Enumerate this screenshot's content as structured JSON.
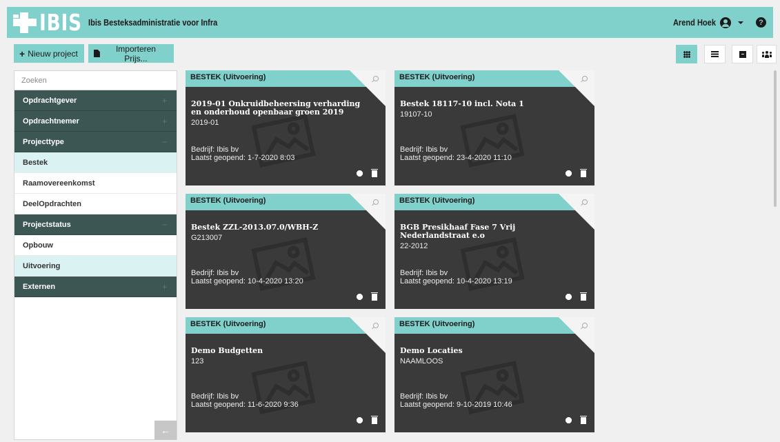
{
  "app": {
    "logo_text": "IBIS",
    "title": "Ibis Besteksadministratie voor Infra",
    "user_name": "Arend Hoek",
    "brand_color": "#80d0cc"
  },
  "toolbar": {
    "new_project_label": "Nieuw project",
    "import_label": "Importeren Prijs...",
    "views": [
      "grid-view",
      "list-view",
      "archive",
      "users"
    ]
  },
  "sidebar": {
    "search_placeholder": "Zoeken",
    "items": [
      {
        "label": "Opdrachtgever",
        "type": "group",
        "sign": "+"
      },
      {
        "label": "Opdrachtnemer",
        "type": "group",
        "sign": "+"
      },
      {
        "label": "Projecttype",
        "type": "group",
        "sign": "−"
      },
      {
        "label": "Bestek",
        "type": "item",
        "selected": true
      },
      {
        "label": "Raamovereenkomst",
        "type": "item"
      },
      {
        "label": "DeelOpdrachten",
        "type": "item"
      },
      {
        "label": "Projectstatus",
        "type": "group",
        "sign": "−"
      },
      {
        "label": "Opbouw",
        "type": "item"
      },
      {
        "label": "Uitvoering",
        "type": "item",
        "selected": true
      },
      {
        "label": "Externen",
        "type": "group",
        "sign": "+"
      }
    ]
  },
  "cards": [
    {
      "header": "BESTEK (Uitvoering)",
      "title": "2019-01 Onkruidbeheersing verharding en onderhoud openbaar groen 2019",
      "code": "2019-01",
      "company": "Bedrijf: Ibis bv",
      "last_opened": "Laatst geopend: 1-7-2020 8:03"
    },
    {
      "header": "BESTEK (Uitvoering)",
      "title": "Bestek 18117-10 incl. Nota 1",
      "code": "19107-10",
      "company": "Bedrijf: Ibis bv",
      "last_opened": "Laatst geopend: 23-4-2020 11:10"
    },
    {
      "header": "BESTEK (Uitvoering)",
      "title": "Bestek ZZL-2013.07.0/WBH-Z",
      "code": "G213007",
      "company": "Bedrijf: Ibis bv",
      "last_opened": "Laatst geopend: 10-4-2020 13:20"
    },
    {
      "header": "BESTEK (Uitvoering)",
      "title": "BGB Presikhaaf Fase 7 Vrij Nederlandstraat e.o",
      "code": "22-2012",
      "company": "Bedrijf: Ibis bv",
      "last_opened": "Laatst geopend: 10-4-2020 13:19"
    },
    {
      "header": "BESTEK (Uitvoering)",
      "title": "Demo Budgetten",
      "code": "123",
      "company": "Bedrijf: Ibis bv",
      "last_opened": "Laatst geopend: 11-6-2020 9:36"
    },
    {
      "header": "BESTEK (Uitvoering)",
      "title": "Demo Locaties",
      "code": "NAAMLOOS",
      "company": "Bedrijf: Ibis bv",
      "last_opened": "Laatst geopend: 9-10-2019 10:46"
    }
  ]
}
